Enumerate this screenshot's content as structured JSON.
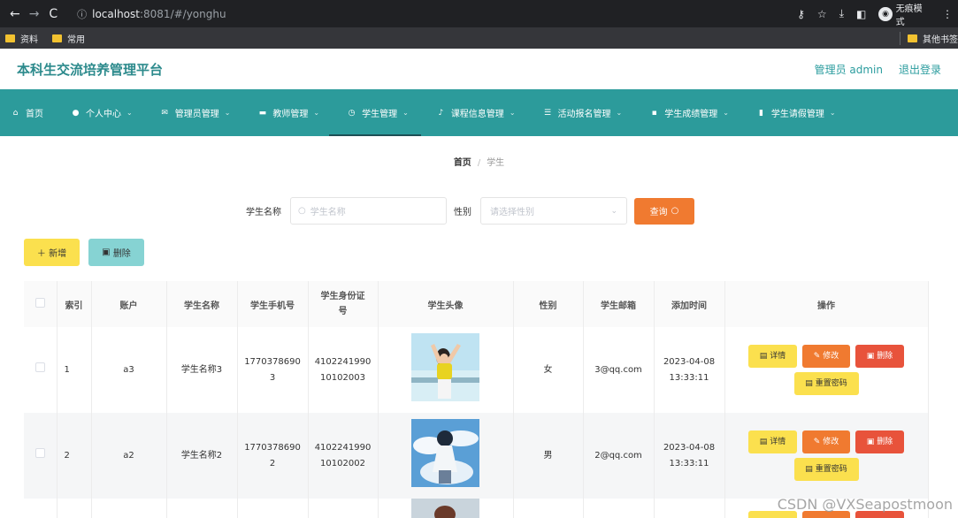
{
  "browser": {
    "url_info": "ⓘ",
    "url_host": "localhost",
    "url_path": ":8081/#/yonghu",
    "incognito_label": "无痕模式",
    "bookmarks": [
      "资料",
      "常用"
    ],
    "bookmarks_right": "其他书签"
  },
  "header": {
    "title": "本科生交流培养管理平台",
    "admin_label": "管理员 admin",
    "logout_label": "退出登录"
  },
  "nav": {
    "items": [
      {
        "label": "首页",
        "icon": "home-icon",
        "chevron": false
      },
      {
        "label": "个人中心",
        "icon": "user-icon",
        "chevron": true
      },
      {
        "label": "管理员管理",
        "icon": "mail-icon",
        "chevron": true
      },
      {
        "label": "教师管理",
        "icon": "briefcase-icon",
        "chevron": true
      },
      {
        "label": "学生管理",
        "icon": "clock-icon",
        "chevron": true
      },
      {
        "label": "课程信息管理",
        "icon": "mic-icon",
        "chevron": true
      },
      {
        "label": "活动报名管理",
        "icon": "menu-icon",
        "chevron": true
      },
      {
        "label": "学生成绩管理",
        "icon": "chat-icon",
        "chevron": true
      },
      {
        "label": "学生请假管理",
        "icon": "bar-chart-icon",
        "chevron": true
      }
    ],
    "active_index": 4
  },
  "breadcrumb": {
    "home": "首页",
    "separator": "/",
    "current": "学生"
  },
  "search": {
    "name_label": "学生名称",
    "name_placeholder": "学生名称",
    "gender_label": "性别",
    "gender_placeholder": "请选择性别",
    "query_button": "查询"
  },
  "actions": {
    "add_button": "新增",
    "delete_button": "删除"
  },
  "table": {
    "columns": [
      "索引",
      "账户",
      "学生名称",
      "学生手机号",
      "学生身份证号",
      "学生头像",
      "性别",
      "学生邮箱",
      "添加时间",
      "操作"
    ],
    "rows": [
      {
        "index": "1",
        "account": "a3",
        "name": "学生名称3",
        "phone_l1": "1770378690",
        "phone_l2": "3",
        "id_l1": "4102241990",
        "id_l2": "10102003",
        "gender": "女",
        "email": "3@qq.com",
        "date": "2023-04-08",
        "time": "13:33:11"
      },
      {
        "index": "2",
        "account": "a2",
        "name": "学生名称2",
        "phone_l1": "1770378690",
        "phone_l2": "2",
        "id_l1": "4102241990",
        "id_l2": "10102002",
        "gender": "男",
        "email": "2@qq.com",
        "date": "2023-04-08",
        "time": "13:33:11"
      }
    ],
    "op_labels": {
      "detail": "详情",
      "edit": "修改",
      "remove": "删除",
      "reset": "重置密码"
    }
  },
  "watermark": "CSDN @VXSeapostmoon"
}
